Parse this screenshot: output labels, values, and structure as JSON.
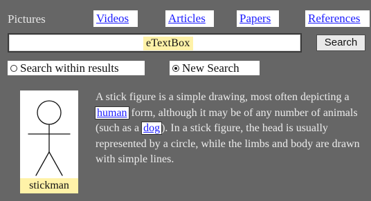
{
  "nav": {
    "label": "Pictures",
    "links": [
      "Videos",
      "Articles",
      "Papers",
      "References"
    ]
  },
  "search": {
    "placeholder": "eTextBox",
    "button_label": "Search"
  },
  "radios": [
    {
      "label": "Search within results",
      "checked": false
    },
    {
      "label": "New Search",
      "checked": true
    }
  ],
  "figure": {
    "caption": "stickman",
    "icon": "stick-figure-drawing"
  },
  "description": {
    "part1": "A stick figure is a simple drawing, most often depicting a ",
    "link1": "human",
    "part2": " form, although it may be of any number of animals (such as a ",
    "link2": "dog",
    "part3": ").  In a stick figure, the head is usually represented by a circle, while the limbs and body are drawn with simple lines."
  },
  "colors": {
    "background": "#666666",
    "link": "#1a1aff",
    "highlight": "#fff2a8"
  }
}
